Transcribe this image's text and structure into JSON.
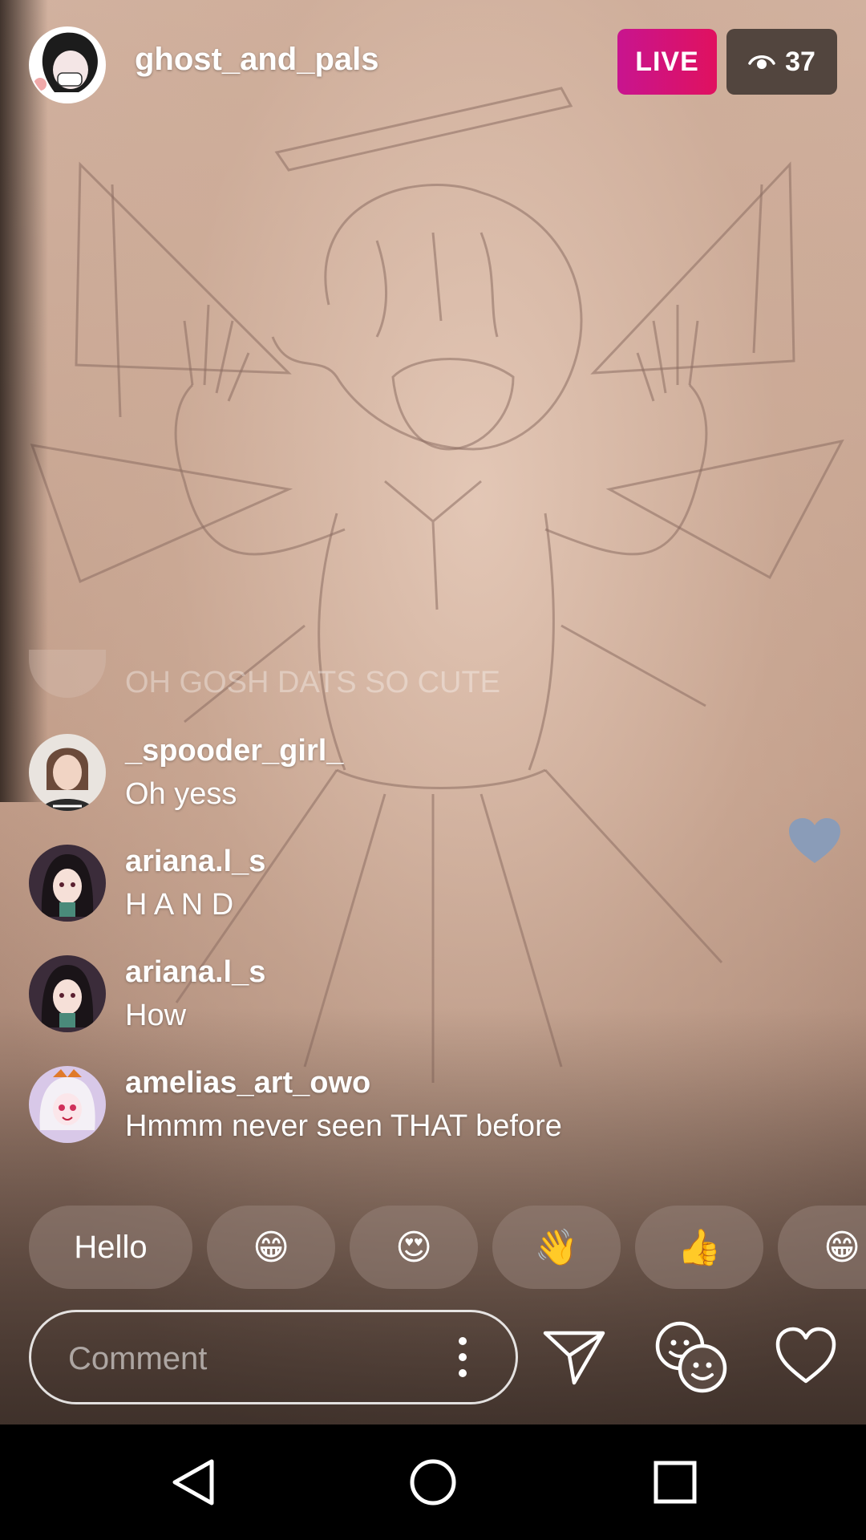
{
  "header": {
    "host_username": "ghost_and_pals",
    "live_label": "LIVE",
    "viewer_count": "37",
    "viewer_icon": "eye-icon"
  },
  "comments": {
    "faded": {
      "text": "OH GOSH DATS SO CUTE"
    },
    "items": [
      {
        "username": "_spooder_girl_",
        "text": "Oh yess"
      },
      {
        "username": "ariana.l_s",
        "text": "H A N D"
      },
      {
        "username": "ariana.l_s",
        "text": "How"
      },
      {
        "username": "amelias_art_owo",
        "text": "Hmmm never seen THAT before"
      }
    ]
  },
  "quick_reactions": [
    {
      "label": "Hello"
    },
    {
      "label": "😁"
    },
    {
      "label": "😍"
    },
    {
      "label": "👋"
    },
    {
      "label": "👍"
    },
    {
      "label": "😁"
    }
  ],
  "composer": {
    "placeholder": "Comment",
    "menu_icon": "more-vertical-icon",
    "send_icon": "send-icon",
    "people_icon": "faces-icon",
    "like_icon": "heart-outline-icon"
  },
  "navbar": {
    "back_icon": "back-triangle-icon",
    "home_icon": "home-circle-icon",
    "recent_icon": "recents-square-icon"
  },
  "colors": {
    "live_gradient_start": "#c8148f",
    "live_gradient_end": "#e0115f",
    "floating_heart": "#8a9cb8"
  }
}
